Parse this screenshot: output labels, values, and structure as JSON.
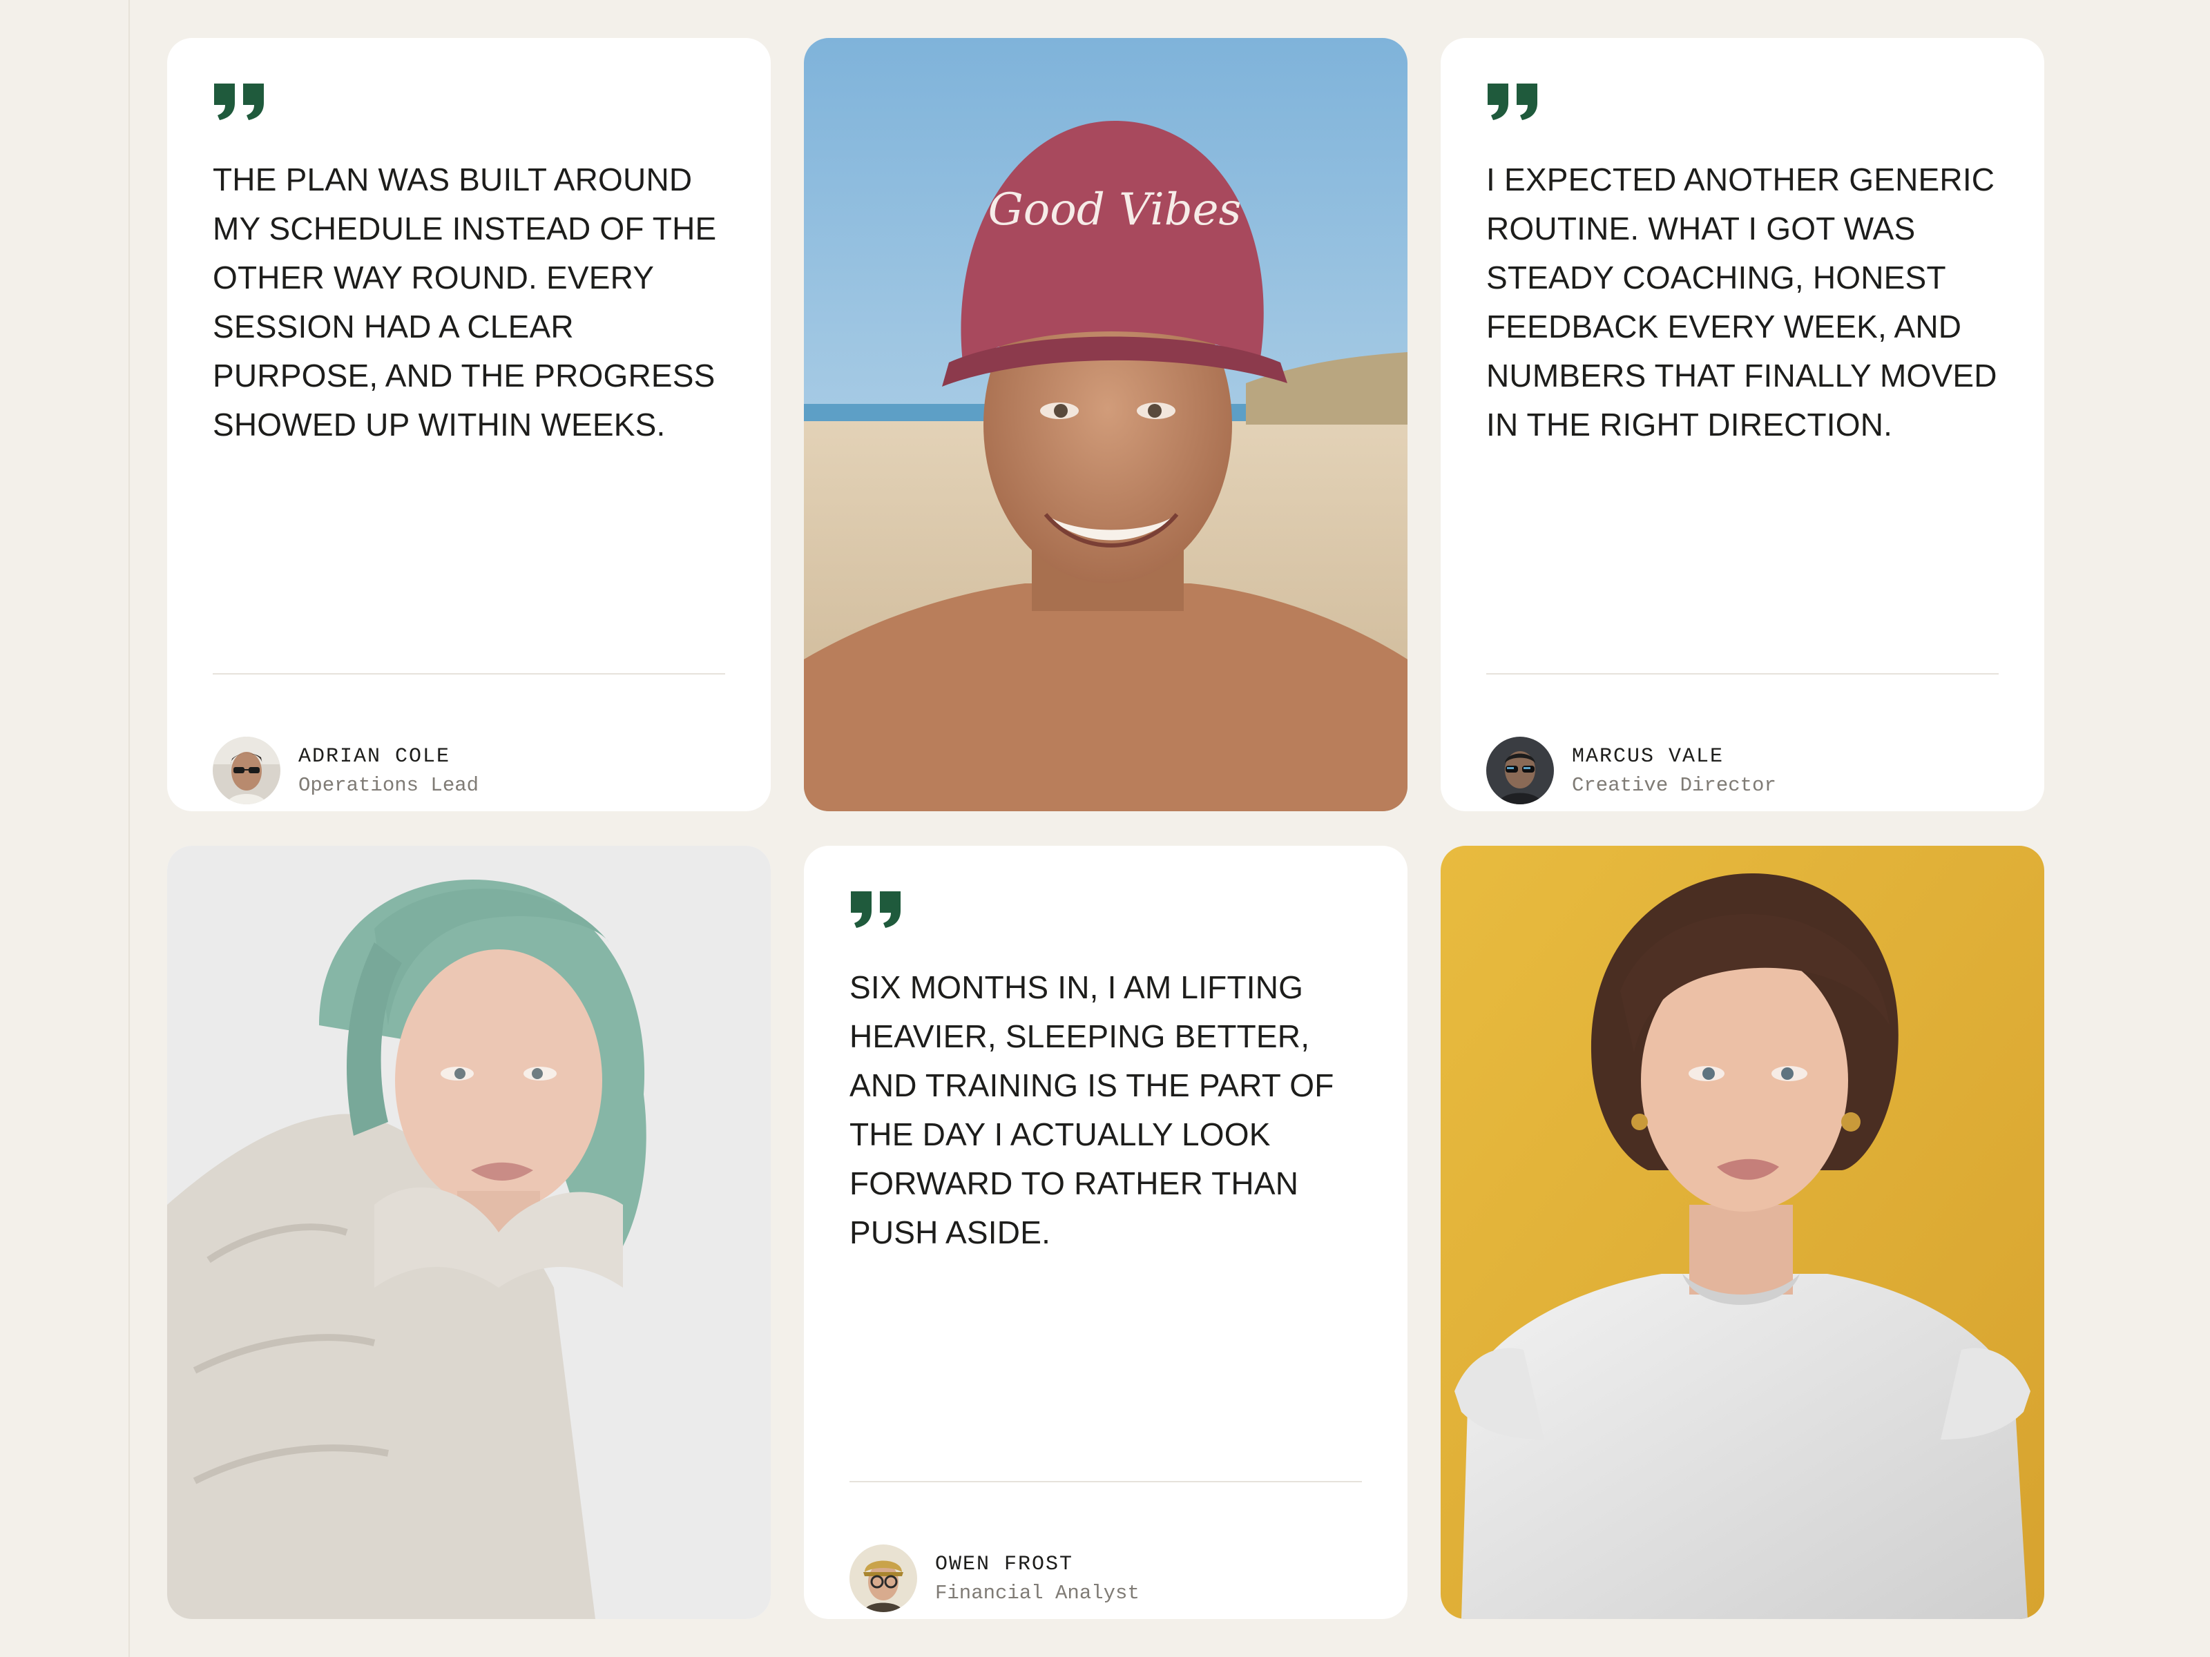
{
  "colors": {
    "page_bg": "#f3f0ea",
    "card_bg": "#ffffff",
    "accent_quote": "#1f5a3c",
    "text": "#1d1d1b",
    "muted": "#7f7b75"
  },
  "testimonials": [
    {
      "quote": "The plan was built around my schedule instead of the other way round. Every session had a clear purpose, and the progress showed up within weeks.",
      "name": "Adrian Cole",
      "role": "Operations Lead"
    },
    {
      "quote": "I expected another generic routine. What I got was steady coaching, honest feedback every week, and numbers that finally moved in the right direction.",
      "name": "Marcus Vale",
      "role": "Creative Director"
    },
    {
      "quote": "Six months in, I am lifting heavier, sleeping better, and training is the part of the day I actually look forward to rather than push aside.",
      "name": "Owen Frost",
      "role": "Financial Analyst"
    }
  ],
  "photos": {
    "beach_cap_text": "Good Vibes"
  },
  "icons": {
    "quote": "closing-quote-icon"
  }
}
